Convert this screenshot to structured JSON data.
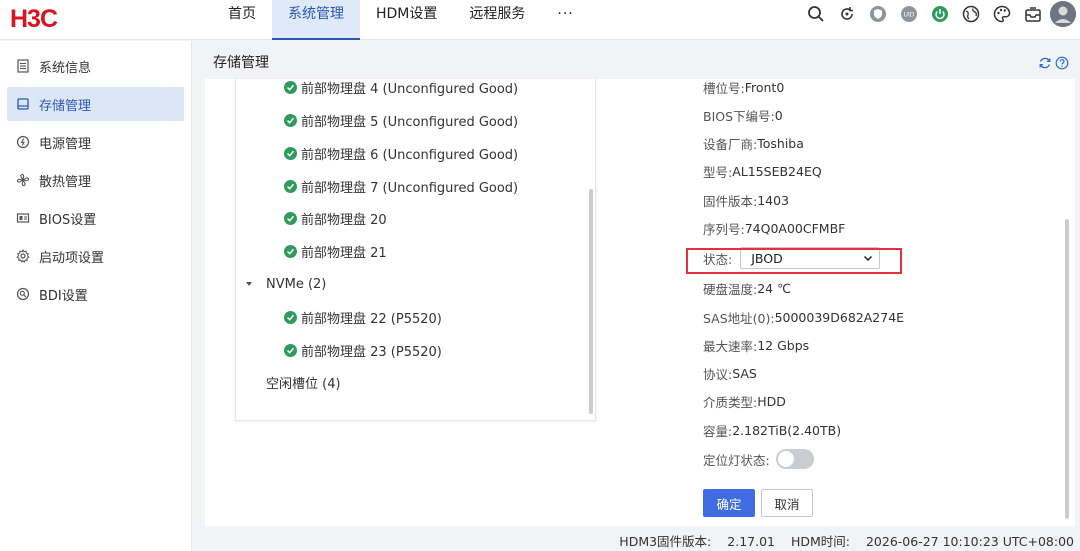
{
  "header": {
    "logo_text": "H3C",
    "nav": [
      {
        "label": "首页"
      },
      {
        "label": "系统管理"
      },
      {
        "label": "HDM设置"
      },
      {
        "label": "远程服务"
      },
      {
        "label": "···"
      }
    ],
    "icons": [
      "search-icon",
      "refresh-icon",
      "shield-icon",
      "uid-icon",
      "power-icon",
      "globe-icon",
      "palette-icon",
      "inbox-icon",
      "avatar-icon"
    ],
    "uid_text": "UID",
    "accent_color": "#2d56b8"
  },
  "sidebar": {
    "items": [
      {
        "label": "系统信息",
        "icon": "document-icon"
      },
      {
        "label": "存储管理",
        "icon": "storage-icon"
      },
      {
        "label": "电源管理",
        "icon": "power-outline-icon"
      },
      {
        "label": "散热管理",
        "icon": "fan-icon"
      },
      {
        "label": "BIOS设置",
        "icon": "chip-icon"
      },
      {
        "label": "启动项设置",
        "icon": "gear-icon"
      },
      {
        "label": "BDI设置",
        "icon": "bdi-icon"
      }
    ]
  },
  "page": {
    "title": "存储管理"
  },
  "tree": {
    "disks": [
      {
        "label": "前部物理盘 4 (Unconfigured Good)"
      },
      {
        "label": "前部物理盘 5 (Unconfigured Good)"
      },
      {
        "label": "前部物理盘 6 (Unconfigured Good)"
      },
      {
        "label": "前部物理盘 7 (Unconfigured Good)"
      },
      {
        "label": "前部物理盘 20"
      },
      {
        "label": "前部物理盘 21"
      }
    ],
    "nvme_group": "NVMe (2)",
    "nvme_disks": [
      {
        "label": "前部物理盘 22 (P5520)"
      },
      {
        "label": "前部物理盘 23 (P5520)"
      }
    ],
    "free_slots": "空闲槽位 (4)",
    "ok_color": "#2e9b5d"
  },
  "detail": {
    "slot": {
      "label": "槽位号:",
      "value": "Front0"
    },
    "bios_no": {
      "label": "BIOS下编号:",
      "value": "0"
    },
    "vendor": {
      "label": "设备厂商:",
      "value": "Toshiba"
    },
    "model": {
      "label": "型号:",
      "value": "AL15SEB24EQ"
    },
    "firmware": {
      "label": "固件版本:",
      "value": "1403"
    },
    "serial": {
      "label": "序列号:",
      "value": "74Q0A00CFMBF"
    },
    "status": {
      "label": "状态:",
      "value": "JBOD"
    },
    "temp": {
      "label": "硬盘温度:",
      "value": "24 ℃"
    },
    "sas": {
      "label": "SAS地址(0):",
      "value": "5000039D682A274E"
    },
    "speed": {
      "label": "最大速率:",
      "value": "12 Gbps"
    },
    "protocol": {
      "label": "协议:",
      "value": "SAS"
    },
    "media": {
      "label": "介质类型:",
      "value": "HDD"
    },
    "capacity": {
      "label": "容量:",
      "value": "2.182TiB(2.40TB)"
    },
    "locator": {
      "label": "定位灯状态:",
      "on": false
    },
    "confirm_label": "确定",
    "cancel_label": "取消",
    "highlight_color": "#e0313c"
  },
  "footer": {
    "version_label": "HDM3固件版本:",
    "version": "2.17.01",
    "time_label": "HDM时间:",
    "time": "2026-06-27 10:10:23 UTC+08:00"
  }
}
